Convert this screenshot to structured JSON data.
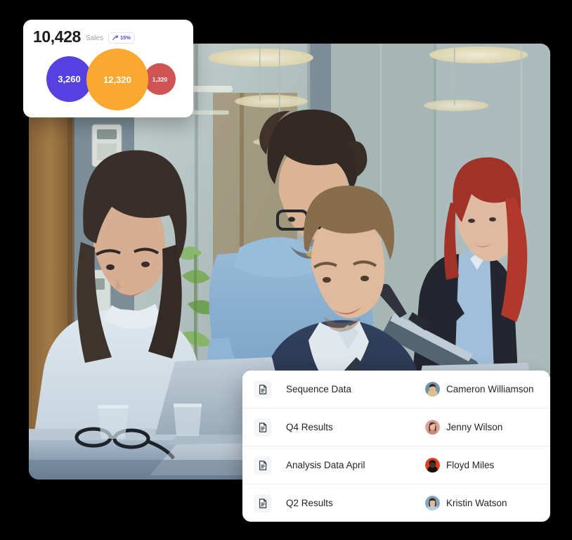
{
  "stats_card": {
    "value": "10,428",
    "label": "Sales",
    "badge": {
      "icon": "trend-up-icon",
      "percent": "15%",
      "color": "#4f46e5"
    },
    "bubbles": [
      {
        "value": "3,260",
        "color": "#5640e0"
      },
      {
        "value": "12,320",
        "color": "#f9a830"
      },
      {
        "value": "1,320",
        "color": "#cf5454"
      }
    ]
  },
  "hero": {
    "alt": "Four office colleagues collaborating around laptops at a glass table",
    "icon": "team-meeting-photo"
  },
  "files_panel": {
    "rows": [
      {
        "icon": "document-icon",
        "name": "Sequence Data",
        "owner": "Cameron Williamson",
        "avatar_bg": "#6f93ad",
        "avatar_hair": "#2b2320",
        "avatar_skin": "#e3b392"
      },
      {
        "icon": "document-icon",
        "name": "Q4 Results",
        "owner": "Jenny Wilson",
        "avatar_bg": "#d9a0a0",
        "avatar_hair": "#5a3724",
        "avatar_skin": "#e9bd9b"
      },
      {
        "icon": "document-icon",
        "name": "Analysis Data April",
        "owner": "Floyd Miles",
        "avatar_bg": "#e23d1f",
        "avatar_hair": "#140f0d",
        "avatar_skin": "#4a3028"
      },
      {
        "icon": "document-icon",
        "name": "Q2 Results",
        "owner": "Kristin Watson",
        "avatar_bg": "#7fa6c4",
        "avatar_hair": "#3a2722",
        "avatar_skin": "#e6b694"
      }
    ]
  },
  "theme": {
    "background": "#000000",
    "card_background": "#ffffff",
    "text_primary": "#22252a",
    "text_muted": "#9aa0a8",
    "divider": "#eceef0"
  }
}
